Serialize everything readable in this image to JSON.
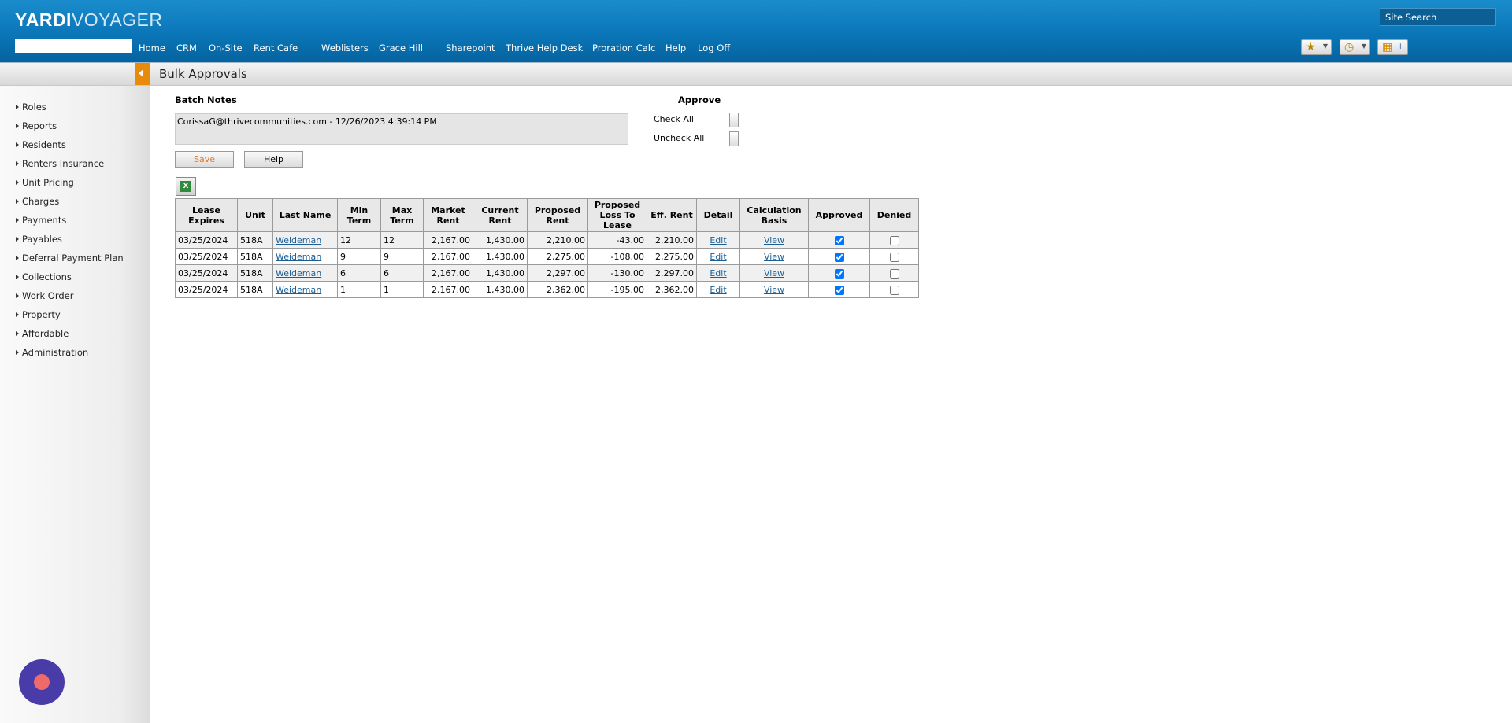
{
  "header": {
    "logo_bold": "YARDI",
    "logo_light": "VOYAGER",
    "site_search": "Site Search",
    "nav": [
      "Home",
      "CRM",
      "On-Site",
      "Rent Cafe",
      "Weblisters",
      "Grace Hill",
      "Sharepoint",
      "Thrive Help Desk",
      "Proration Calc",
      "Help",
      "Log Off"
    ],
    "icons": [
      "star-icon",
      "history-clock-icon",
      "dashboard-grid-icon"
    ]
  },
  "page_title": "Bulk Approvals",
  "sidebar": [
    "Roles",
    "Reports",
    "Residents",
    "Renters Insurance",
    "Unit Pricing",
    "Charges",
    "Payments",
    "Payables",
    "Deferral Payment Plan",
    "Collections",
    "Work Order",
    "Property",
    "Affordable",
    "Administration"
  ],
  "batch": {
    "label": "Batch Notes",
    "notes": "CorissaG@thrivecommunities.com - 12/26/2023 4:39:14 PM"
  },
  "approve": {
    "label": "Approve",
    "check_all": "Check All",
    "uncheck_all": "Uncheck All"
  },
  "buttons": {
    "save": "Save",
    "help": "Help"
  },
  "table": {
    "headers": [
      "Lease Expires",
      "Unit",
      "Last Name",
      "Min Term",
      "Max Term",
      "Market Rent",
      "Current Rent",
      "Proposed Rent",
      "Proposed Loss To Lease",
      "Eff. Rent",
      "Detail",
      "Calculation Basis",
      "Approved",
      "Denied"
    ],
    "rows": [
      {
        "lease_expires": "03/25/2024",
        "unit": "518A",
        "last_name": "Weideman",
        "min_term": "12",
        "max_term": "12",
        "market_rent": "2,167.00",
        "current_rent": "1,430.00",
        "proposed_rent": "2,210.00",
        "loss_to_lease": "-43.00",
        "eff_rent": "2,210.00",
        "detail": "Edit",
        "calc_basis": "View",
        "approved": true,
        "denied": false
      },
      {
        "lease_expires": "03/25/2024",
        "unit": "518A",
        "last_name": "Weideman",
        "min_term": "9",
        "max_term": "9",
        "market_rent": "2,167.00",
        "current_rent": "1,430.00",
        "proposed_rent": "2,275.00",
        "loss_to_lease": "-108.00",
        "eff_rent": "2,275.00",
        "detail": "Edit",
        "calc_basis": "View",
        "approved": true,
        "denied": false
      },
      {
        "lease_expires": "03/25/2024",
        "unit": "518A",
        "last_name": "Weideman",
        "min_term": "6",
        "max_term": "6",
        "market_rent": "2,167.00",
        "current_rent": "1,430.00",
        "proposed_rent": "2,297.00",
        "loss_to_lease": "-130.00",
        "eff_rent": "2,297.00",
        "detail": "Edit",
        "calc_basis": "View",
        "approved": true,
        "denied": false
      },
      {
        "lease_expires": "03/25/2024",
        "unit": "518A",
        "last_name": "Weideman",
        "min_term": "1",
        "max_term": "1",
        "market_rent": "2,167.00",
        "current_rent": "1,430.00",
        "proposed_rent": "2,362.00",
        "loss_to_lease": "-195.00",
        "eff_rent": "2,362.00",
        "detail": "Edit",
        "calc_basis": "View",
        "approved": true,
        "denied": false
      }
    ]
  },
  "colors": {
    "header": "#0a76b8",
    "accent_orange": "#e88a0b",
    "link": "#1c5f95",
    "chat_bubble": "#4a3ca8"
  }
}
